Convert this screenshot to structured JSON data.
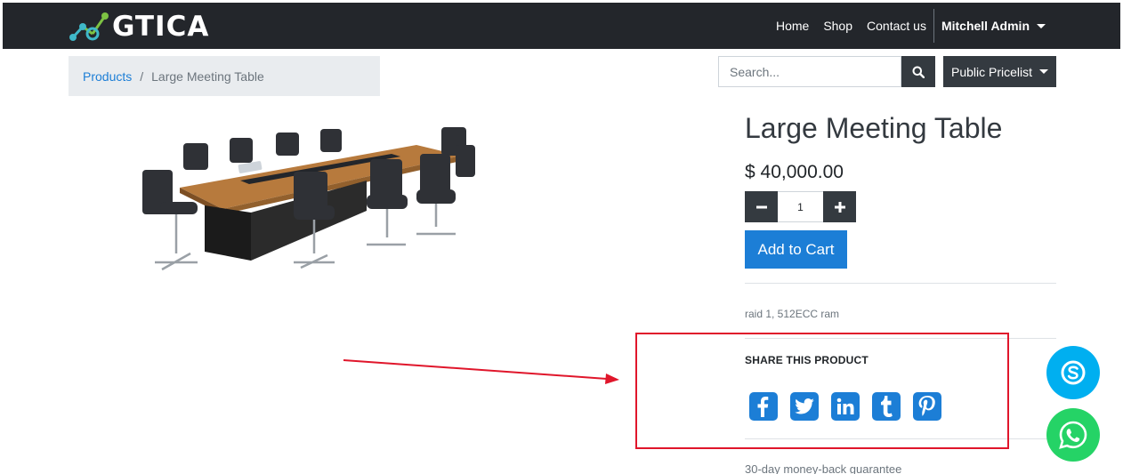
{
  "header": {
    "logo_text": "GTICA",
    "nav": [
      "Home",
      "Shop",
      "Contact us"
    ],
    "user": "Mitchell Admin"
  },
  "breadcrumb": {
    "parent": "Products",
    "separator": "/",
    "current": "Large Meeting Table"
  },
  "search": {
    "placeholder": "Search..."
  },
  "pricelist": {
    "label": "Public Pricelist"
  },
  "product": {
    "title": "Large Meeting Table",
    "price": "$ 40,000.00",
    "quantity": "1",
    "add_to_cart": "Add to Cart",
    "description": "raid 1, 512ECC ram",
    "share_title": "SHARE THIS PRODUCT",
    "share_icons": [
      "facebook-icon",
      "twitter-icon",
      "linkedin-icon",
      "tumblr-icon",
      "pinterest-icon"
    ],
    "guarantee": "30-day money-back guarantee"
  },
  "colors": {
    "navbar": "#23262b",
    "accent": "#1c7ed6",
    "annotation": "#e0162b",
    "skype": "#00aff0",
    "whatsapp": "#25d366"
  }
}
